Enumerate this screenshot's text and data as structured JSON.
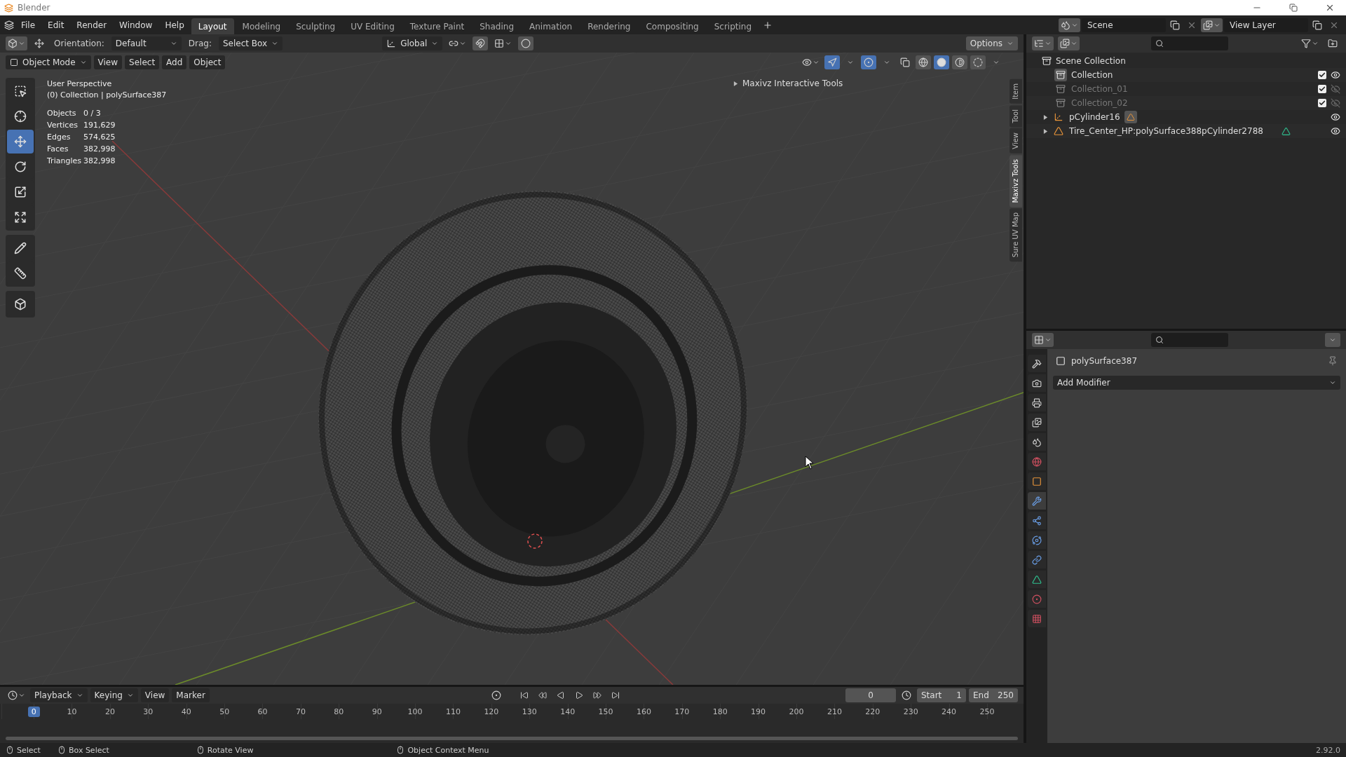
{
  "window": {
    "title": "Blender"
  },
  "menu": [
    "File",
    "Edit",
    "Render",
    "Window",
    "Help"
  ],
  "workspaces": [
    {
      "label": "Layout",
      "selected": true
    },
    {
      "label": "Modeling",
      "selected": false
    },
    {
      "label": "Sculpting",
      "selected": false
    },
    {
      "label": "UV Editing",
      "selected": false
    },
    {
      "label": "Texture Paint",
      "selected": false
    },
    {
      "label": "Shading",
      "selected": false
    },
    {
      "label": "Animation",
      "selected": false
    },
    {
      "label": "Rendering",
      "selected": false
    },
    {
      "label": "Compositing",
      "selected": false
    },
    {
      "label": "Scripting",
      "selected": false
    }
  ],
  "scene": {
    "scene": "Scene",
    "view_layer": "View Layer"
  },
  "tool_header": {
    "orientation_label": "Orientation:",
    "orientation": "Default",
    "drag_label": "Drag:",
    "drag": "Select Box",
    "transform_orientation": "Global",
    "options": "Options"
  },
  "viewport_header": {
    "mode": "Object Mode",
    "menus": [
      "View",
      "Select",
      "Add",
      "Object"
    ],
    "shading": [
      {
        "kind": "wireframe",
        "selected": false
      },
      {
        "kind": "solid",
        "selected": true
      },
      {
        "kind": "material",
        "selected": false
      },
      {
        "kind": "rendered",
        "selected": false
      }
    ]
  },
  "viewport": {
    "view_name": "User Perspective",
    "context": "(0) Collection | polySurface387",
    "stats": [
      {
        "label": "Objects",
        "value": "0 / 3"
      },
      {
        "label": "Vertices",
        "value": "191,629"
      },
      {
        "label": "Edges",
        "value": "574,625"
      },
      {
        "label": "Faces",
        "value": "382,998"
      },
      {
        "label": "Triangles",
        "value": "382,998"
      }
    ],
    "tools": [
      {
        "kind": "select-box",
        "selected": false
      },
      {
        "kind": "cursor",
        "selected": false
      },
      {
        "kind": "move",
        "selected": true
      },
      {
        "kind": "rotate",
        "selected": false
      },
      {
        "kind": "scale",
        "selected": false
      },
      {
        "kind": "transform",
        "selected": false
      },
      {
        "kind": "annotate",
        "selected": false
      },
      {
        "kind": "measure",
        "selected": false
      },
      {
        "kind": "add-cube",
        "selected": false
      }
    ],
    "panel_title": "Maxivz Interactive Tools",
    "side_tabs": [
      {
        "label": "Item",
        "selected": false
      },
      {
        "label": "Tool",
        "selected": false
      },
      {
        "label": "View",
        "selected": false
      },
      {
        "label": "Maxivz Tools",
        "selected": true
      },
      {
        "label": "Sure UV Map",
        "selected": false
      }
    ]
  },
  "outliner": {
    "root": "Scene Collection",
    "children": [
      {
        "kind": "collection",
        "name": "Collection",
        "active": true,
        "checked": true,
        "visible": true
      },
      {
        "kind": "collection",
        "name": "Collection_01",
        "active": false,
        "checked": true,
        "visible": false
      },
      {
        "kind": "collection",
        "name": "Collection_02",
        "active": false,
        "checked": true,
        "visible": false
      },
      {
        "kind": "empty",
        "name": "pCylinder16",
        "expanded": false,
        "visible": true
      },
      {
        "kind": "mesh",
        "name": "Tire_Center_HP:polySurface388pCylinder2788",
        "expanded": false,
        "visible": true
      }
    ]
  },
  "properties": {
    "tabs": [
      {
        "kind": "tool",
        "selected": false
      },
      {
        "kind": "render",
        "selected": false
      },
      {
        "kind": "output",
        "selected": false
      },
      {
        "kind": "view-layer",
        "selected": false
      },
      {
        "kind": "scene",
        "selected": false
      },
      {
        "kind": "world",
        "selected": false
      },
      {
        "kind": "object",
        "selected": false
      },
      {
        "kind": "modifiers",
        "selected": true
      },
      {
        "kind": "particles",
        "selected": false
      },
      {
        "kind": "physics",
        "selected": false
      },
      {
        "kind": "constraints",
        "selected": false
      },
      {
        "kind": "data",
        "selected": false
      },
      {
        "kind": "material",
        "selected": false
      },
      {
        "kind": "texture",
        "selected": false
      }
    ],
    "object": "polySurface387",
    "add_modifier": "Add Modifier"
  },
  "timeline": {
    "menus": [
      "Playback",
      "Keying",
      "View",
      "Marker"
    ],
    "current_frame": "0",
    "start_label": "Start",
    "start": "1",
    "end_label": "End",
    "end": "250",
    "frames": [
      {
        "label": "0",
        "selected": true
      },
      {
        "label": "10",
        "selected": false
      },
      {
        "label": "20",
        "selected": false
      },
      {
        "label": "30",
        "selected": false
      },
      {
        "label": "40",
        "selected": false
      },
      {
        "label": "50",
        "selected": false
      },
      {
        "label": "60",
        "selected": false
      },
      {
        "label": "70",
        "selected": false
      },
      {
        "label": "80",
        "selected": false
      },
      {
        "label": "90",
        "selected": false
      },
      {
        "label": "100",
        "selected": false
      },
      {
        "label": "110",
        "selected": false
      },
      {
        "label": "120",
        "selected": false
      },
      {
        "label": "130",
        "selected": false
      },
      {
        "label": "140",
        "selected": false
      },
      {
        "label": "150",
        "selected": false
      },
      {
        "label": "160",
        "selected": false
      },
      {
        "label": "170",
        "selected": false
      },
      {
        "label": "180",
        "selected": false
      },
      {
        "label": "190",
        "selected": false
      },
      {
        "label": "200",
        "selected": false
      },
      {
        "label": "210",
        "selected": false
      },
      {
        "label": "220",
        "selected": false
      },
      {
        "label": "230",
        "selected": false
      },
      {
        "label": "240",
        "selected": false
      },
      {
        "label": "250",
        "selected": false
      }
    ]
  },
  "status_bar": {
    "hints": [
      "Select",
      "Box Select",
      "Rotate View",
      "Object Context Menu"
    ],
    "version": "2.92.0"
  }
}
